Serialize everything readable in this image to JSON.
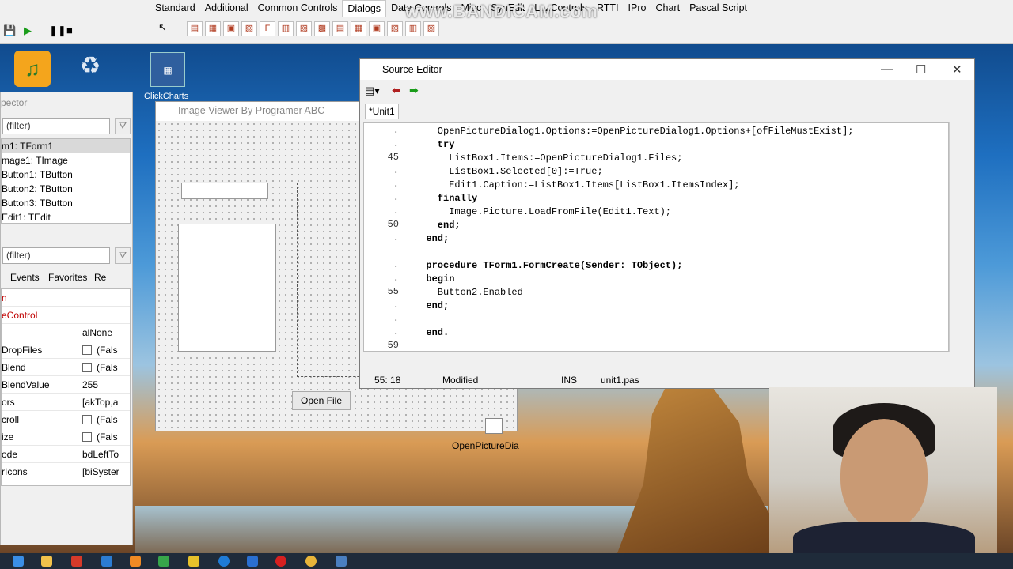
{
  "top_tabs": [
    "Standard",
    "Additional",
    "Common Controls",
    "Dialogs",
    "Data Controls",
    "Misc",
    "SynEdit",
    "LazControls",
    "RTTI",
    "IPro",
    "Chart",
    "Pascal Script"
  ],
  "active_tab": "Dialogs",
  "watermark": "www.BANDICAM.com",
  "desktop_icons": [
    "ClickCharts"
  ],
  "inspector": {
    "title": "pector",
    "filter1": "(filter)",
    "filter2": "(filter)",
    "tree": [
      "m1: TForm1",
      "mage1: TImage",
      "Button1: TButton",
      "Button2: TButton",
      "Button3: TButton",
      "Edit1: TEdit"
    ],
    "tabs": [
      "Events",
      "Favorites",
      "Re"
    ],
    "props": [
      {
        "k": "n",
        "v": ""
      },
      {
        "k": "eControl",
        "v": ""
      },
      {
        "k": "",
        "v": "alNone"
      },
      {
        "k": "DropFiles",
        "v": "(Fals"
      },
      {
        "k": "Blend",
        "v": "(Fals"
      },
      {
        "k": "BlendValue",
        "v": "255"
      },
      {
        "k": "ors",
        "v": "[akTop,a"
      },
      {
        "k": "croll",
        "v": "(Fals"
      },
      {
        "k": "ize",
        "v": "(Fals"
      },
      {
        "k": "ode",
        "v": "bdLeftTo"
      },
      {
        "k": "rIcons",
        "v": "[biSyster"
      }
    ]
  },
  "form": {
    "caption": "Image Viewer By Programer ABC",
    "open_button": "Open File",
    "dialog_label": "OpenPictureDia"
  },
  "source_editor": {
    "title": "Source Editor",
    "tab": "*Unit1",
    "lines": [
      {
        "n": ".",
        "t": "    OpenPictureDialog1.Options:=OpenPictureDialog1.Options+[ofFileMustExist];"
      },
      {
        "n": ".",
        "t": "    try"
      },
      {
        "n": "45",
        "t": "      ListBox1.Items:=OpenPictureDialog1.Files;"
      },
      {
        "n": ".",
        "t": "      ListBox1.Selected[0]:=True;"
      },
      {
        "n": ".",
        "t": "      Edit1.Caption:=ListBox1.Items[ListBox1.ItemsIndex];"
      },
      {
        "n": ".",
        "t": "    finally"
      },
      {
        "n": ".",
        "t": "      Image.Picture.LoadFromFile(Edit1.Text);"
      },
      {
        "n": "50",
        "t": "    end;"
      },
      {
        "n": ".",
        "t": "  end;"
      },
      {
        "n": "",
        "t": ""
      },
      {
        "n": ".",
        "t": "  procedure TForm1.FormCreate(Sender: TObject);"
      },
      {
        "n": ".",
        "t": "  begin"
      },
      {
        "n": "55",
        "t": "    Button2.Enabled"
      },
      {
        "n": ".",
        "t": "  end;"
      },
      {
        "n": ".",
        "t": ""
      },
      {
        "n": ".",
        "t": "  end."
      },
      {
        "n": "59",
        "t": ""
      }
    ],
    "status": {
      "pos": "55: 18",
      "state": "Modified",
      "mode": "INS",
      "file": "unit1.pas"
    }
  },
  "colors": {
    "keyword": "#000000",
    "symbol": "#c00000",
    "accent": "#0078d7"
  }
}
